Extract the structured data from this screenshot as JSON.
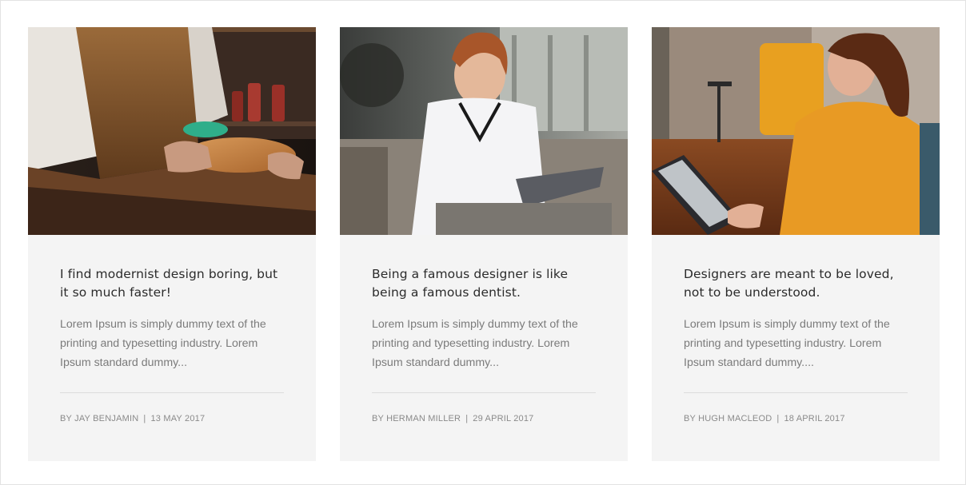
{
  "posts": [
    {
      "image": "shoemaker-photo",
      "title": "I find modernist design boring, but it so much faster!",
      "excerpt": "Lorem Ipsum is simply dummy text of the printing and typesetting industry. Lorem Ipsum standard dummy...",
      "author": "BY JAY BENJAMIN",
      "separator": "|",
      "date": "13 MAY 2017"
    },
    {
      "image": "woman-with-tablet-photo",
      "title": "Being a famous designer is like being a famous dentist.",
      "excerpt": "Lorem Ipsum is simply dummy text of the printing and typesetting industry. Lorem Ipsum standard dummy...",
      "author": "BY HERMAN MILLER",
      "separator": "|",
      "date": "29 APRIL 2017"
    },
    {
      "image": "woman-reading-tablet-photo",
      "title": "Designers are meant to be loved, not to be understood.",
      "excerpt": "Lorem Ipsum is simply dummy text of the printing and typesetting industry. Lorem Ipsum standard dummy....",
      "author": "BY HUGH MACLEOD",
      "separator": "|",
      "date": "18 APRIL 2017"
    }
  ],
  "colors": {
    "card_background": "#f4f4f4",
    "title_text": "#2b2b2b",
    "excerpt_text": "#7b7b7b",
    "meta_text": "#8a8a8a"
  }
}
